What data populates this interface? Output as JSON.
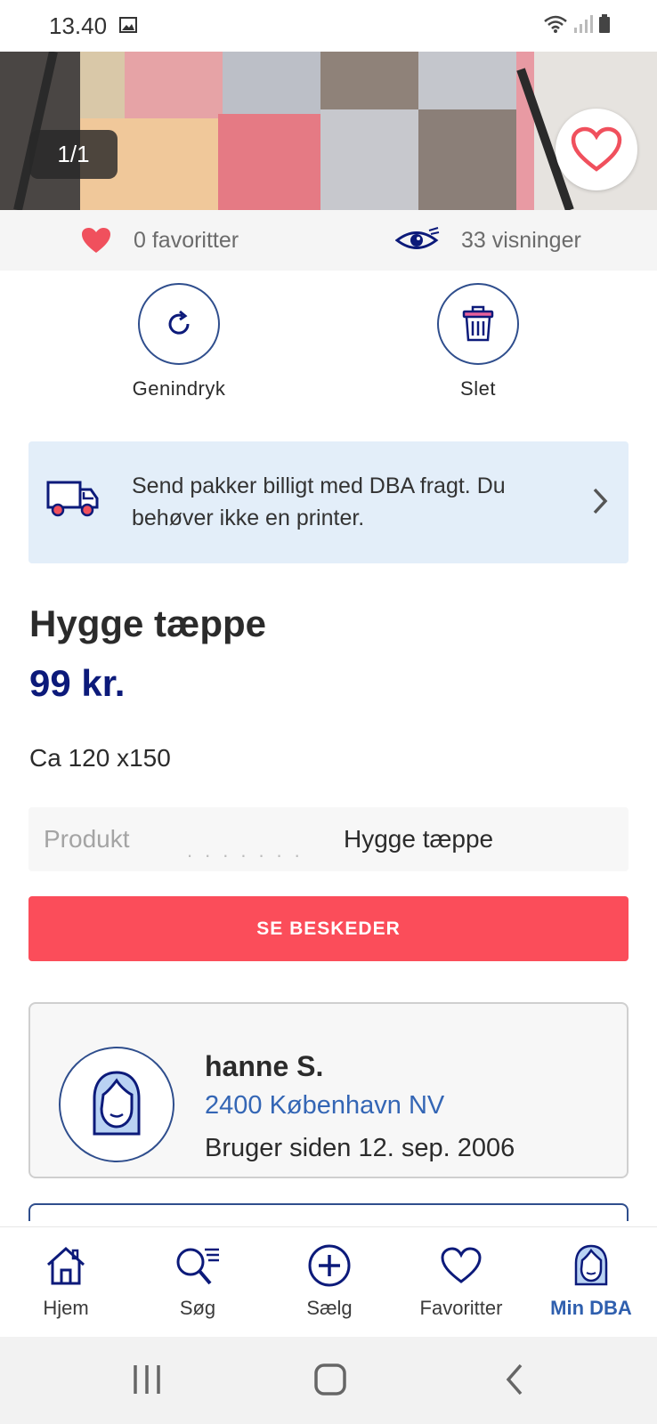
{
  "status_bar": {
    "time": "13.40"
  },
  "hero": {
    "counter": "1/1"
  },
  "stats": {
    "favorites": "0 favoritter",
    "views": "33 visninger"
  },
  "actions": {
    "republish": "Genindryk",
    "delete": "Slet"
  },
  "shipping_banner": {
    "text": "Send pakker billigt med DBA fragt. Du behøver ikke en printer."
  },
  "listing": {
    "title": "Hygge tæppe",
    "price": "99 kr.",
    "description": "Ca 120 x150",
    "attribute_label": "Produkt",
    "attribute_value": "Hygge tæppe"
  },
  "cta": {
    "label": "SE BESKEDER"
  },
  "seller": {
    "name": "hanne S.",
    "location": "2400 København NV",
    "member_since": "Bruger siden 12. sep. 2006"
  },
  "bottom_nav": {
    "items": [
      {
        "label": "Hjem",
        "icon": "home-icon"
      },
      {
        "label": "Søg",
        "icon": "search-icon"
      },
      {
        "label": "Sælg",
        "icon": "plus-circle-icon"
      },
      {
        "label": "Favoritter",
        "icon": "heart-icon"
      },
      {
        "label": "Min DBA",
        "icon": "profile-icon",
        "active": true
      }
    ]
  },
  "colors": {
    "brand_navy": "#0c1a7a",
    "accent_red": "#fb4d5a",
    "link_blue": "#3466b5",
    "banner_bg": "#e3eef9"
  }
}
